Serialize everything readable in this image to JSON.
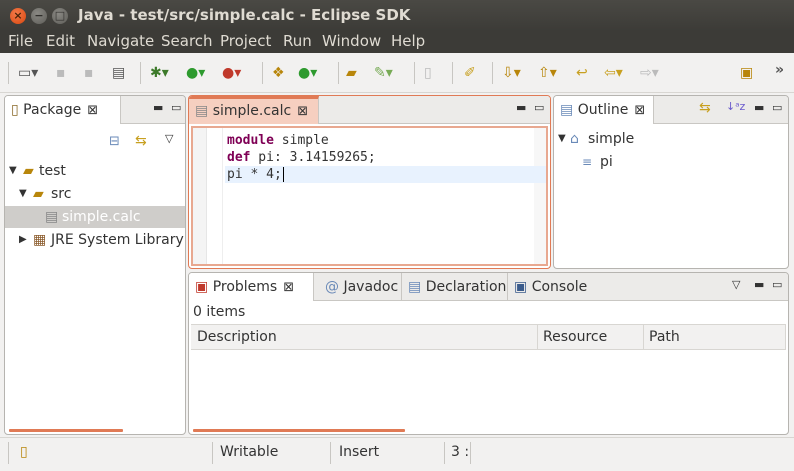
{
  "window": {
    "title": "Java - test/src/simple.calc - Eclipse SDK"
  },
  "menu": [
    "File",
    "Edit",
    "Navigate",
    "Search",
    "Project",
    "Run",
    "Window",
    "Help"
  ],
  "package_view": {
    "tab_label": "Package",
    "tree": [
      {
        "label": "test",
        "level": 0,
        "expanded": true
      },
      {
        "label": "src",
        "level": 1,
        "expanded": true
      },
      {
        "label": "simple.calc",
        "level": 2,
        "selected": true
      },
      {
        "label": "JRE System Library",
        "level": 1,
        "expanded": false
      }
    ]
  },
  "editor": {
    "tab_label": "simple.calc",
    "lines": [
      {
        "kw": "module",
        "rest": " simple"
      },
      {
        "kw": "def",
        "rest": " pi: 3.14159265;"
      },
      {
        "kw": "",
        "rest": "pi * 4;"
      }
    ]
  },
  "outline": {
    "tab_label": "Outline",
    "tree": [
      {
        "label": "simple"
      },
      {
        "label": "pi"
      }
    ]
  },
  "bottom": {
    "tabs": [
      "Problems",
      "Javadoc",
      "Declaration",
      "Console"
    ],
    "items_count": "0 items",
    "columns": [
      "Description",
      "Resource",
      "Path"
    ]
  },
  "status": {
    "writable": "Writable",
    "insert": "Insert",
    "position": "3 :"
  },
  "colors": {
    "accent": "#e07a55",
    "keyword": "#7f0055"
  }
}
